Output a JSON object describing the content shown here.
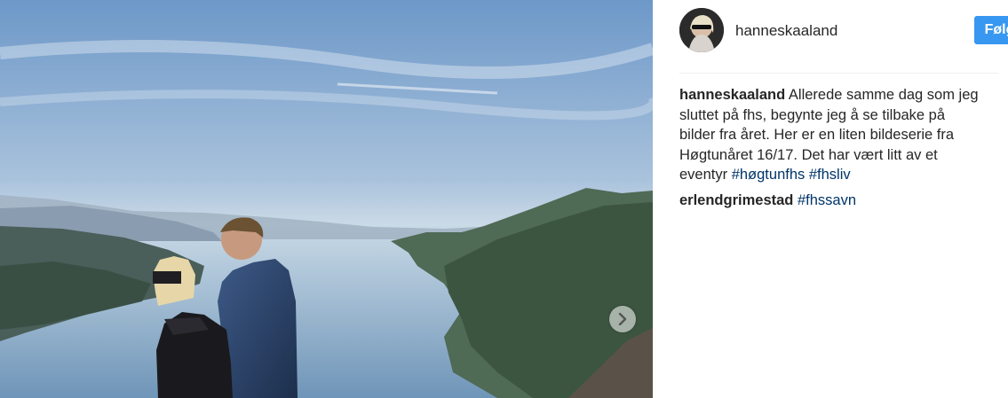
{
  "post": {
    "author": "hanneskaaland",
    "follow_label": "Følg",
    "carousel_next": "›"
  },
  "comments": [
    {
      "user": "hanneskaaland",
      "text": " Allerede samme dag som jeg sluttet på fhs, begynte jeg å se tilbake på bilder fra året. Her er en liten bildeserie fra Høgtunåret 16/17. Det har vært litt av et eventyr ",
      "tags": [
        "#høgtunfhs",
        "#fhsliv"
      ]
    },
    {
      "user": "erlendgrimestad",
      "text": " ",
      "tags": [
        "#fhssavn"
      ]
    }
  ],
  "icons": {
    "carousel_next": "chevron-right-icon"
  },
  "colors": {
    "follow_button": "#3897f0",
    "hashtag": "#003569",
    "divider": "#efefef"
  }
}
